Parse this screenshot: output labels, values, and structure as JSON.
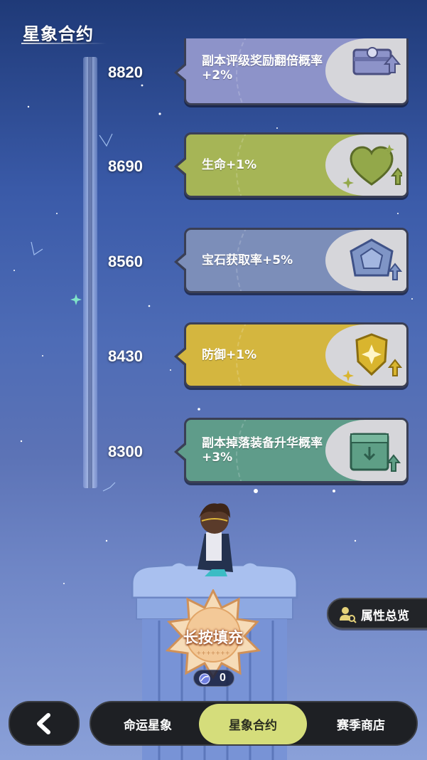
{
  "header": {
    "title": "星象合约"
  },
  "tiers": [
    {
      "value": "8820",
      "bonus": "副本评级奖励翻倍概率+2%",
      "color": "#8d93c9",
      "icon": "treasure-chest-icon"
    },
    {
      "value": "8690",
      "bonus": "生命+1%",
      "color": "#a6b556",
      "icon": "heart-icon"
    },
    {
      "value": "8560",
      "bonus": "宝石获取率+5%",
      "color": "#7c8eb9",
      "icon": "gem-icon"
    },
    {
      "value": "8430",
      "bonus": "防御+1%",
      "color": "#d4b63f",
      "icon": "shield-icon"
    },
    {
      "value": "8300",
      "bonus": "副本掉落装备升华概率+3%",
      "color": "#5f9c8a",
      "icon": "box-icon"
    }
  ],
  "fill_button": {
    "label": "长按填充"
  },
  "counter": {
    "value": "0"
  },
  "overview_button": {
    "label": "属性总览"
  },
  "nav": {
    "tabs": [
      {
        "label": "命运星象",
        "active": false
      },
      {
        "label": "星象合约",
        "active": true
      },
      {
        "label": "赛季商店",
        "active": false
      }
    ]
  }
}
